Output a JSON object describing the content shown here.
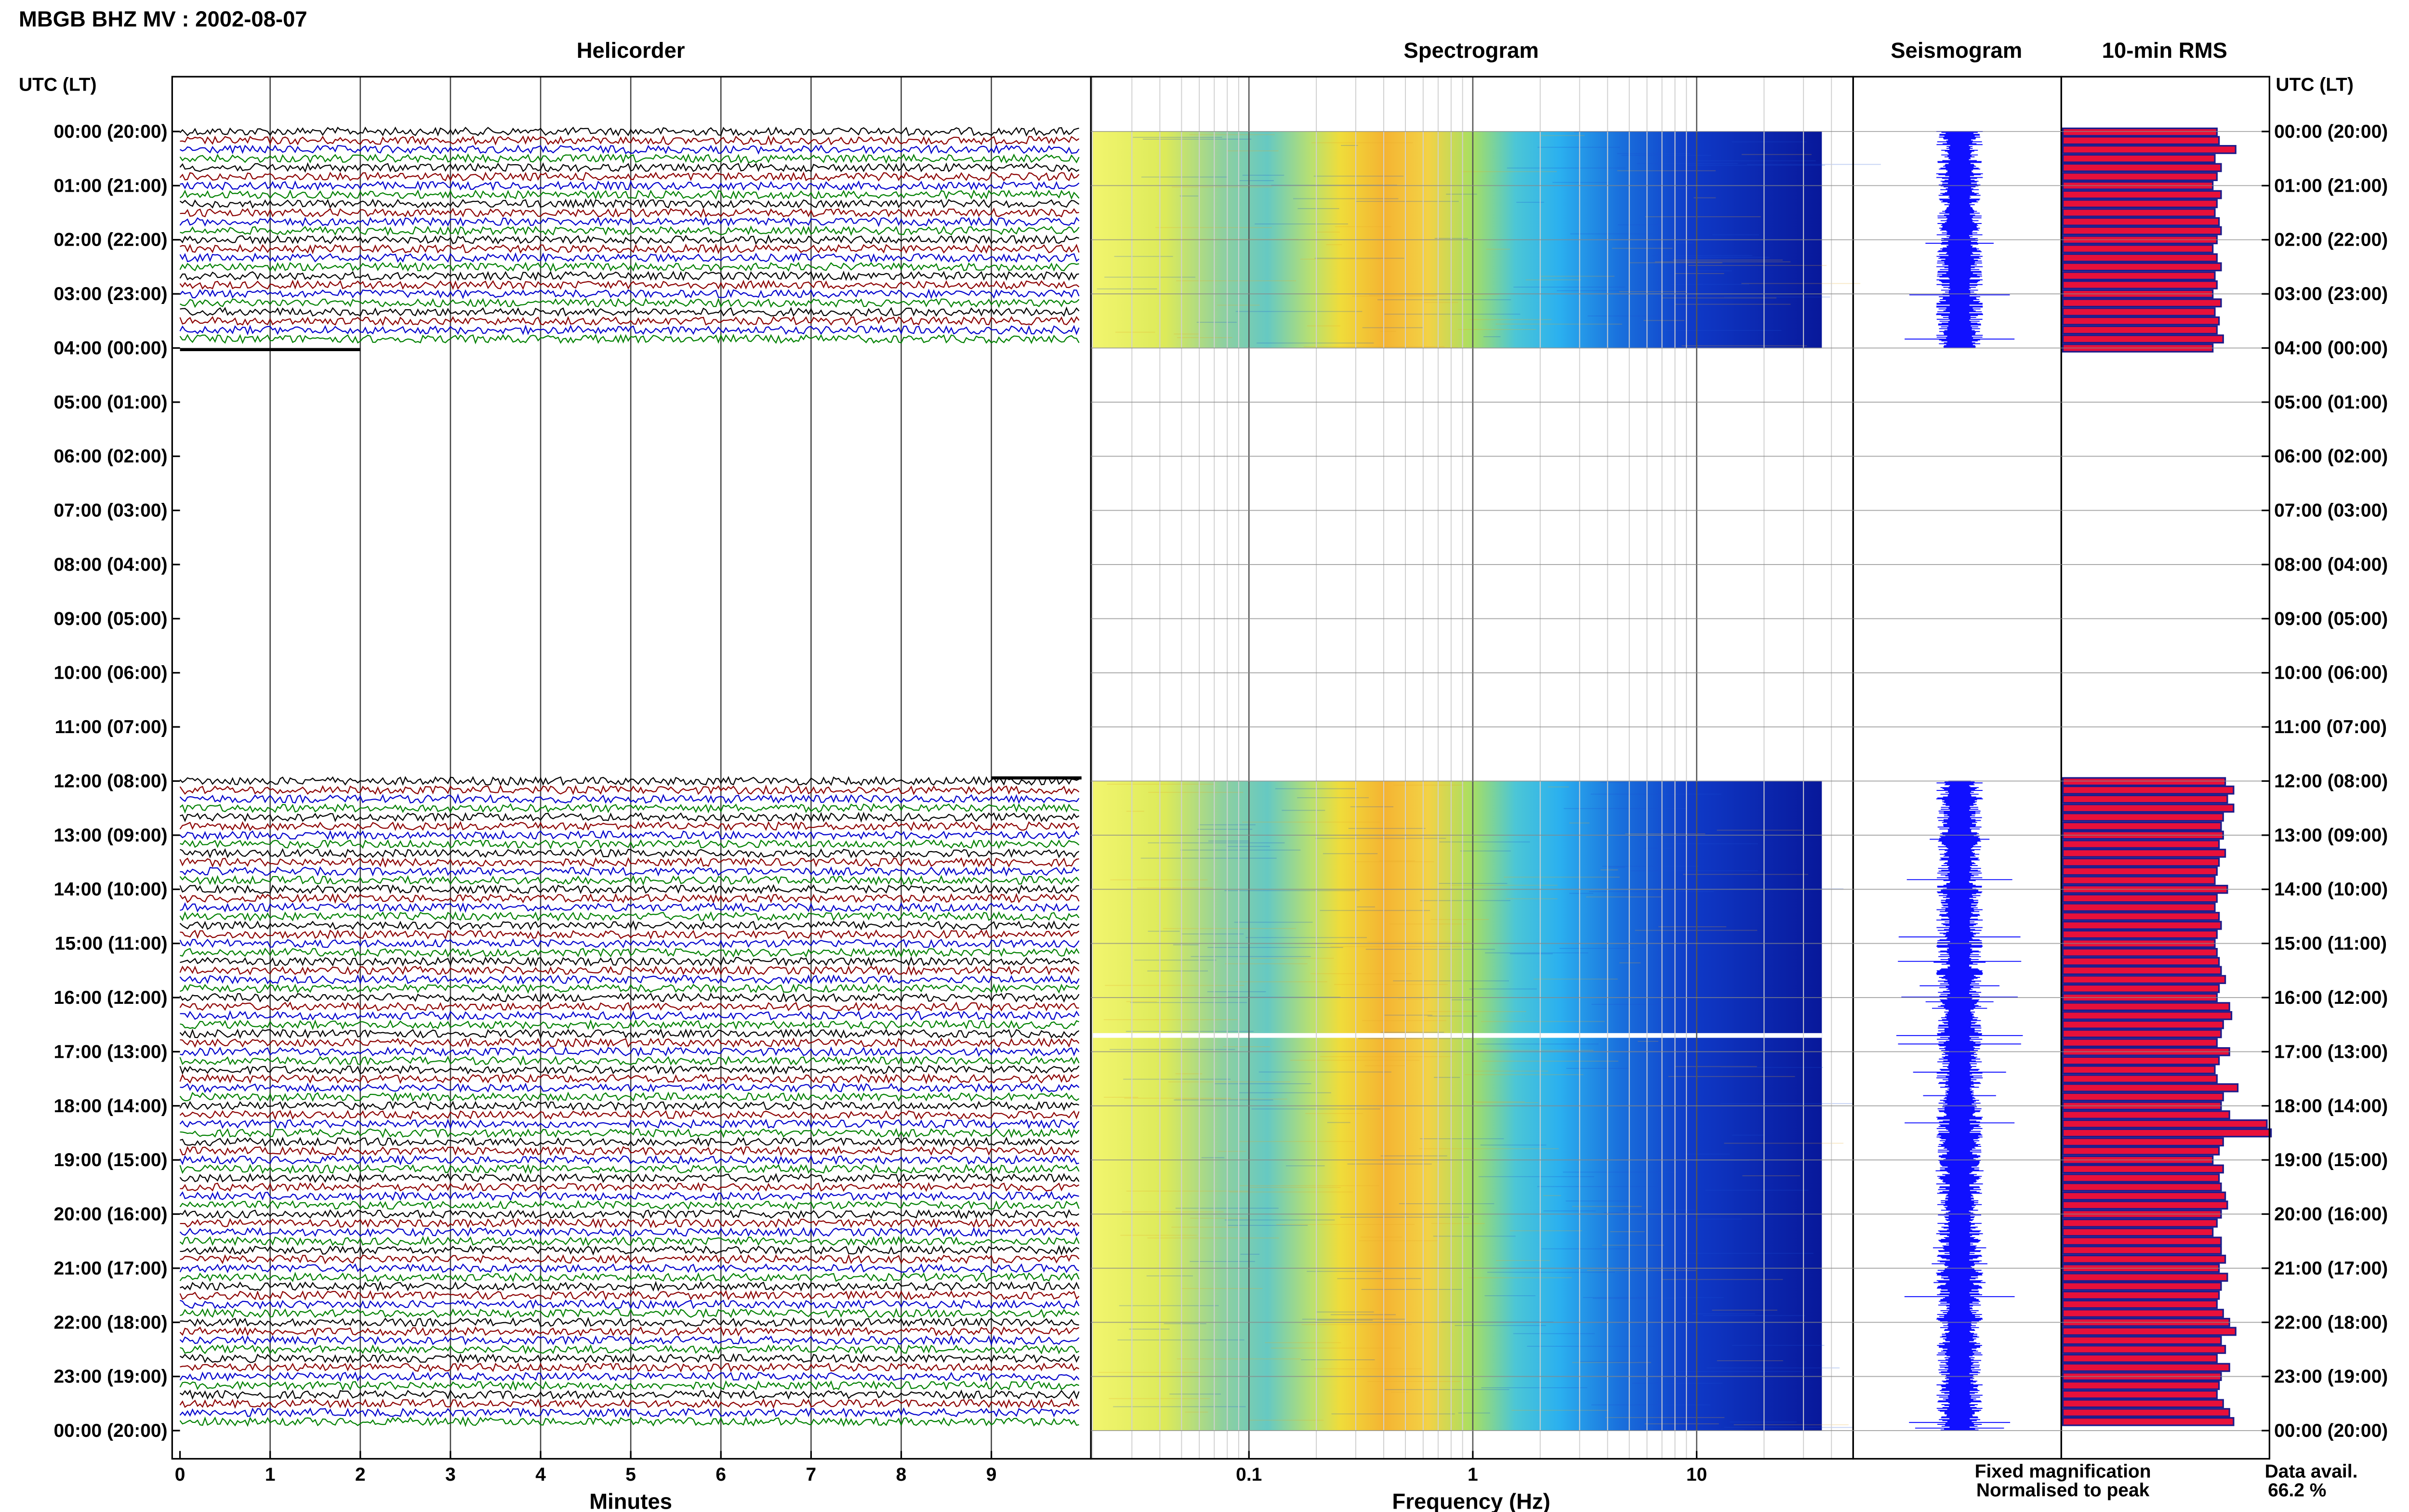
{
  "title": "MBGB BHZ MV : 2002-08-07",
  "panels": {
    "helicorder": "Helicorder",
    "spectrogram": "Spectrogram",
    "seismogram": "Seismogram",
    "rms": "10-min RMS"
  },
  "axis_labels": {
    "utc_left": "UTC (LT)",
    "utc_right": "UTC (LT)",
    "minutes": "Minutes",
    "frequency": "Frequency (Hz)"
  },
  "legend": {
    "fixed": "Fixed magnification",
    "normalised": "Normalised to peak",
    "fixed_color": "#1a1aff",
    "normalised_color": "#ff1a1a"
  },
  "data_avail": {
    "label": "Data avail.",
    "value": "66.2 %"
  },
  "colors": {
    "trace_colors": [
      "#000000",
      "#8b0000",
      "#0000cc",
      "#008000"
    ],
    "rms_fill": "#e8103a",
    "rms_edge": "#1c1c8c",
    "seismo": "#1010ff"
  },
  "chart_data": {
    "type": "heatmap",
    "time_labels": [
      "00:00 (20:00)",
      "01:00 (21:00)",
      "02:00 (22:00)",
      "03:00 (23:00)",
      "04:00 (00:00)",
      "05:00 (01:00)",
      "06:00 (02:00)",
      "07:00 (03:00)",
      "08:00 (04:00)",
      "09:00 (05:00)",
      "10:00 (06:00)",
      "11:00 (07:00)",
      "12:00 (08:00)",
      "13:00 (09:00)",
      "14:00 (10:00)",
      "15:00 (11:00)",
      "16:00 (12:00)",
      "17:00 (13:00)",
      "18:00 (14:00)",
      "19:00 (15:00)",
      "20:00 (16:00)",
      "21:00 (17:00)",
      "22:00 (18:00)",
      "23:00 (19:00)",
      "00:00 (20:00)"
    ],
    "minutes_ticks": [
      "0",
      "1",
      "2",
      "3",
      "4",
      "5",
      "6",
      "7",
      "8",
      "9"
    ],
    "freq_ticks": [
      "0.1",
      "1",
      "10"
    ],
    "freq_range_hz": [
      0.02,
      50
    ],
    "data_hours": [
      [
        0,
        4
      ],
      [
        12,
        24
      ]
    ],
    "rms_values": [
      0.74,
      0.75,
      0.83,
      0.73,
      0.76,
      0.74,
      0.72,
      0.76,
      0.74,
      0.73,
      0.75,
      0.76,
      0.74,
      0.72,
      0.74,
      0.76,
      0.73,
      0.74,
      0.72,
      0.76,
      0.73,
      0.75,
      0.74,
      0.77,
      0.72,
      0.78,
      0.82,
      0.79,
      0.82,
      0.77,
      0.76,
      0.77,
      0.75,
      0.78,
      0.75,
      0.74,
      0.73,
      0.79,
      0.74,
      0.73,
      0.75,
      0.76,
      0.74,
      0.73,
      0.74,
      0.75,
      0.76,
      0.78,
      0.75,
      0.74,
      0.8,
      0.81,
      0.77,
      0.76,
      0.74,
      0.8,
      0.75,
      0.73,
      0.74,
      0.84,
      0.77,
      0.76,
      0.8,
      0.98,
      1.0,
      0.77,
      0.75,
      0.72,
      0.77,
      0.75,
      0.76,
      0.78,
      0.79,
      0.76,
      0.74,
      0.72,
      0.76,
      0.76,
      0.78,
      0.75,
      0.79,
      0.76,
      0.75,
      0.74,
      0.77,
      0.8,
      0.83,
      0.76,
      0.78,
      0.74,
      0.8,
      0.76,
      0.75,
      0.74,
      0.77,
      0.8,
      0.82,
      0.8,
      0.91,
      0.92,
      0.88,
      0.85,
      0.78,
      0.76,
      0.84
    ]
  }
}
